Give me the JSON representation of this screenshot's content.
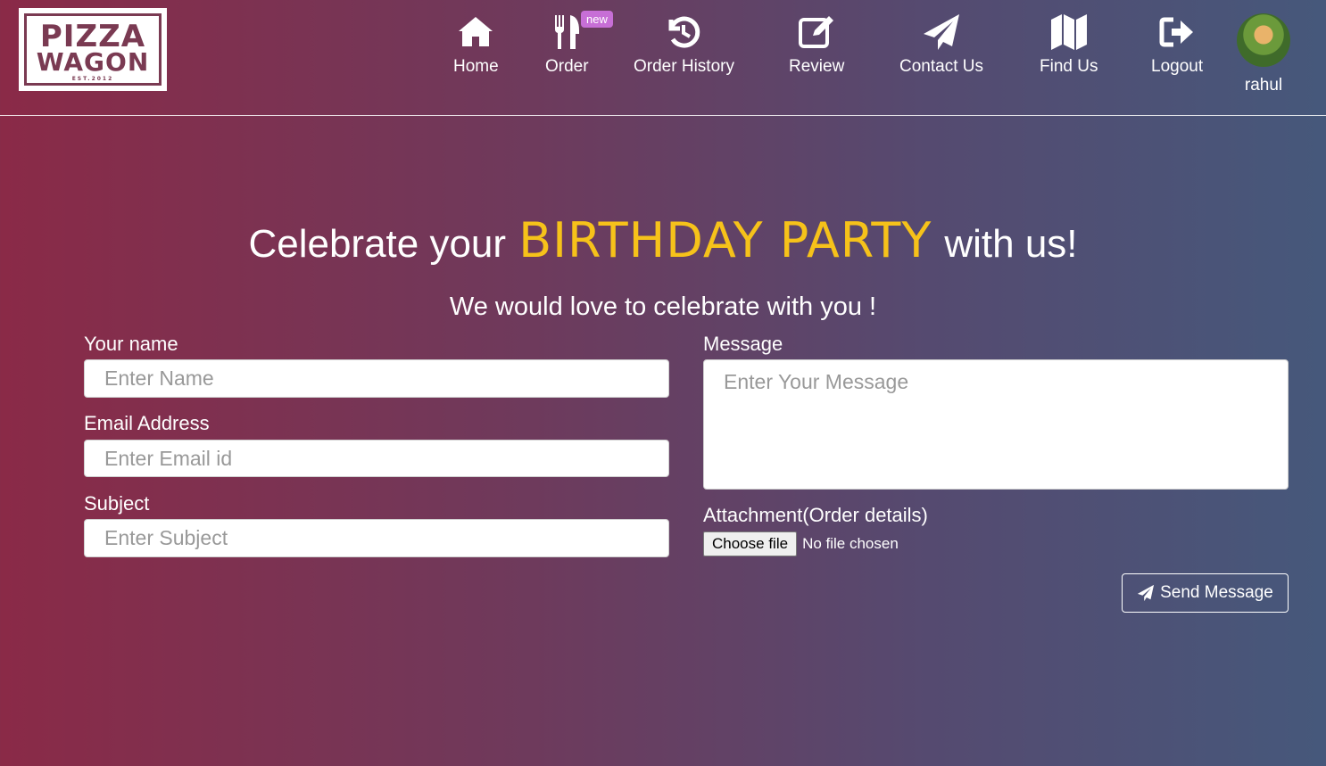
{
  "brand": {
    "logo_line1": "PIZZA",
    "logo_line2": "WAGON",
    "logo_line3": "EST.2012"
  },
  "nav": {
    "home": "Home",
    "order": "Order",
    "order_badge": "new",
    "history": "Order History",
    "review": "Review",
    "contact": "Contact Us",
    "find": "Find Us",
    "logout": "Logout",
    "user": "rahul"
  },
  "hero": {
    "title_pre": "Celebrate your",
    "title_highlight": "BIRTHDAY PARTY",
    "title_post": "with us!",
    "subtitle": "We would love to celebrate with you !"
  },
  "form": {
    "name_label": "Your name",
    "name_placeholder": "Enter Name",
    "email_label": "Email Address",
    "email_placeholder": "Enter Email id",
    "subject_label": "Subject",
    "subject_placeholder": "Enter Subject",
    "message_label": "Message",
    "message_placeholder": "Enter Your Message",
    "attachment_label": "Attachment(Order details)",
    "choose_file": "Choose file",
    "no_file": "No file chosen",
    "send": "Send Message"
  },
  "colors": {
    "highlight": "#f6c21a",
    "badge": "#c76fd6",
    "gradient_left": "#8a2a47",
    "gradient_right": "#46587b"
  },
  "icons": [
    "home-icon",
    "utensils-icon",
    "history-icon",
    "edit-icon",
    "paper-plane-icon",
    "map-icon",
    "sign-out-icon"
  ]
}
